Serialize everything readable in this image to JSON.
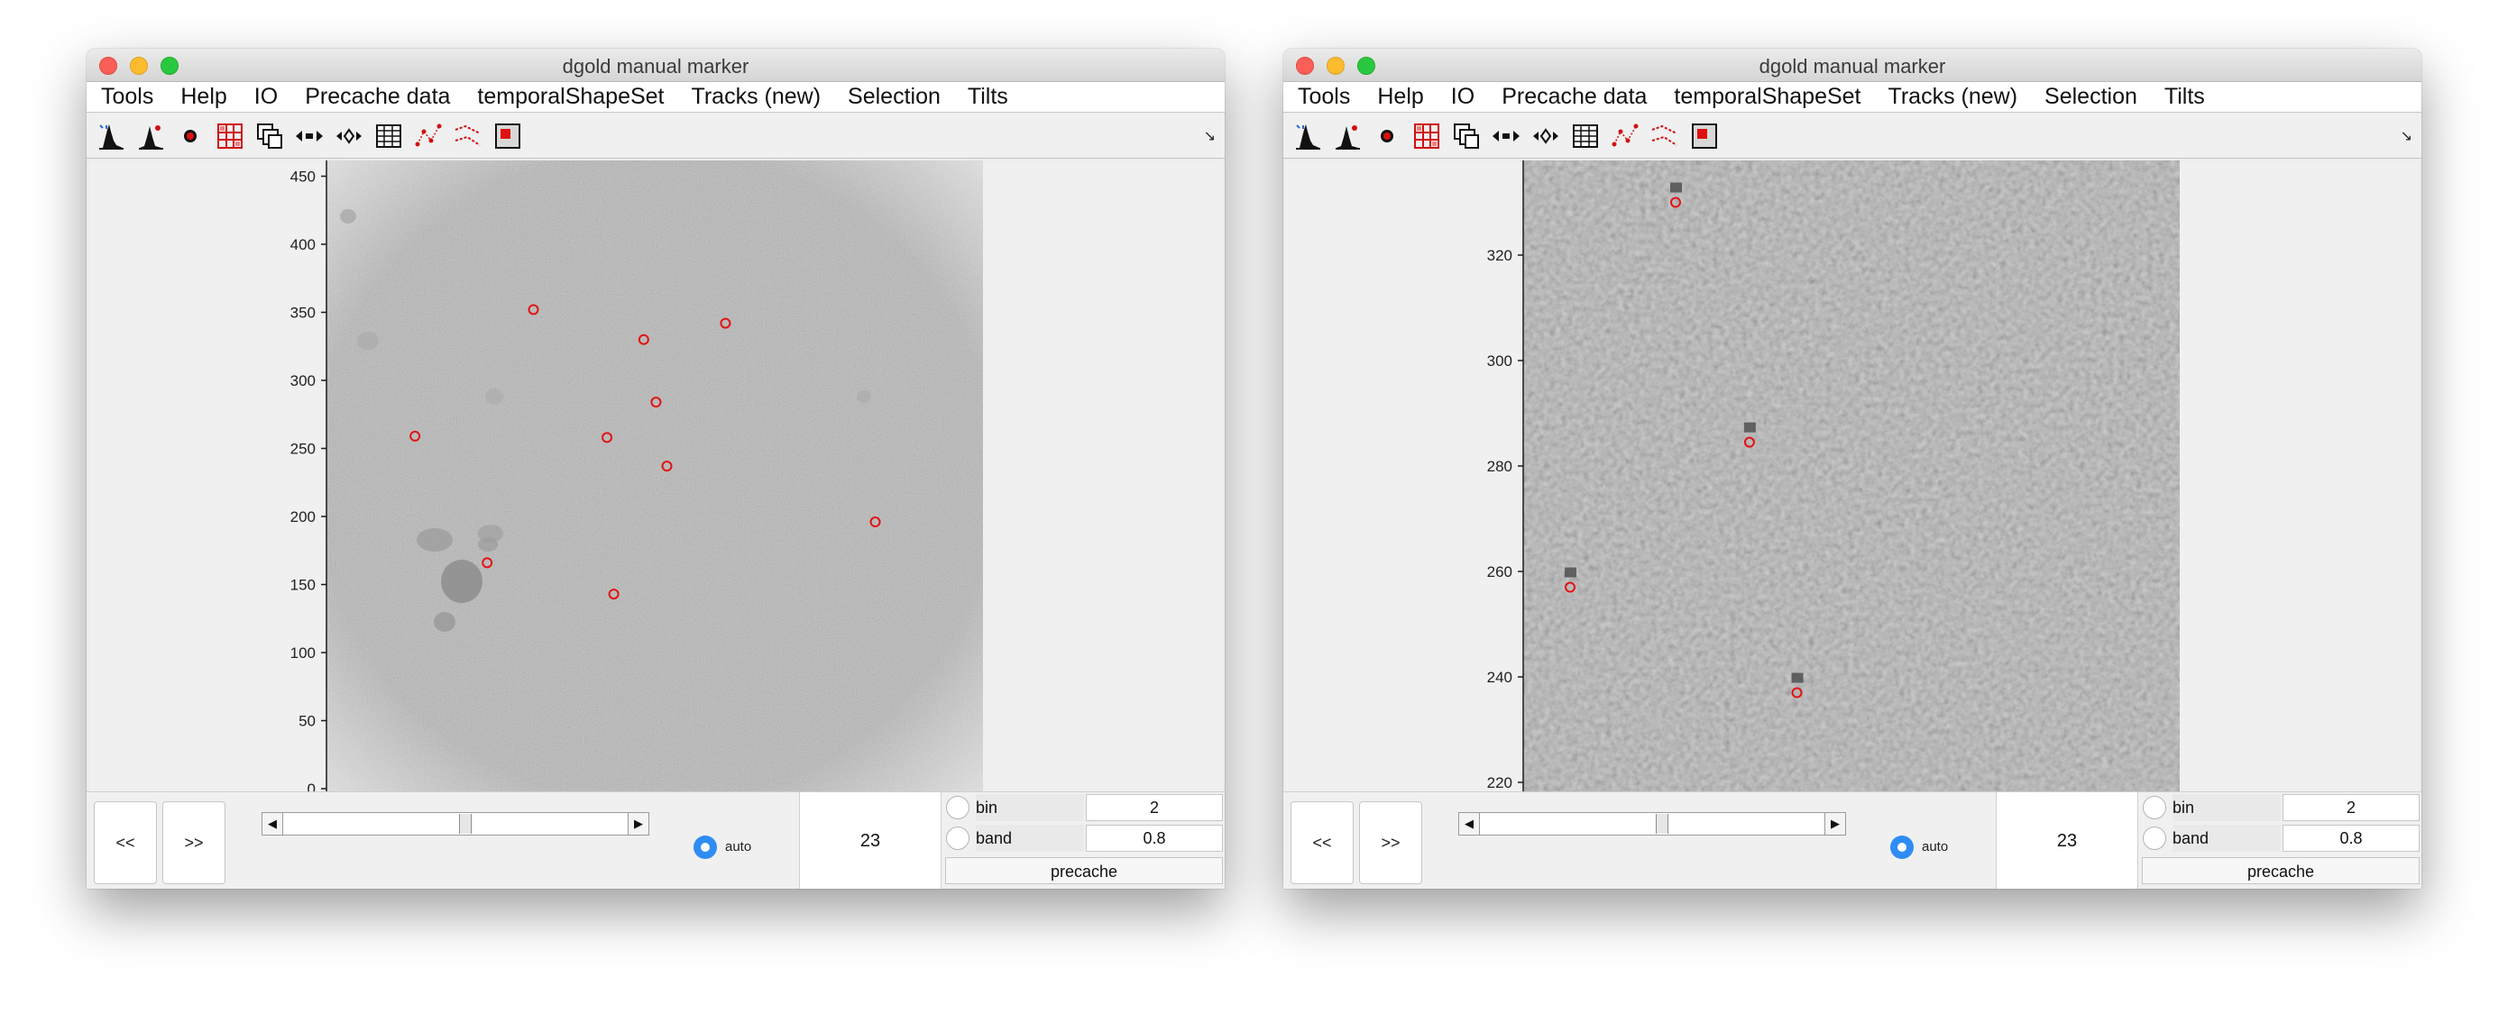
{
  "windows": [
    {
      "title": "dgold manual marker",
      "menu": [
        "Tools",
        "Help",
        "IO",
        "Precache data",
        "temporalShapeSet",
        "Tracks (new)",
        "Selection",
        "Tilts"
      ],
      "toolbar_icons": [
        "histogram-icon",
        "histogram-point-icon",
        "red-dot-icon",
        "red-grid-icon",
        "copy-stack-icon",
        "move-arrows-icon",
        "align-arrows-icon",
        "table-icon",
        "scatter-markers-icon",
        "track-lines-icon",
        "red-square-icon"
      ],
      "plot": {
        "yticks": [
          "450",
          "400",
          "350",
          "300",
          "250",
          "200",
          "150",
          "100",
          "50",
          "0"
        ],
        "markers": [
          {
            "x": 152,
            "y": 352
          },
          {
            "x": 233,
            "y": 330
          },
          {
            "x": 293,
            "y": 342
          },
          {
            "x": 242,
            "y": 284
          },
          {
            "x": 65,
            "y": 259
          },
          {
            "x": 206,
            "y": 258
          },
          {
            "x": 250,
            "y": 237
          },
          {
            "x": 403,
            "y": 196
          },
          {
            "x": 118,
            "y": 166
          },
          {
            "x": 211,
            "y": 143
          }
        ]
      },
      "controls": {
        "prev_label": "<<",
        "next_label": ">>",
        "auto_label": "auto",
        "frame_value": "23",
        "params": [
          {
            "label": "bin",
            "value": "2"
          },
          {
            "label": "band",
            "value": "0.8"
          }
        ],
        "precache_label": "precache"
      }
    },
    {
      "title": "dgold manual marker",
      "menu": [
        "Tools",
        "Help",
        "IO",
        "Precache data",
        "temporalShapeSet",
        "Tracks (new)",
        "Selection",
        "Tilts"
      ],
      "toolbar_icons": [
        "histogram-icon",
        "histogram-point-icon",
        "red-dot-icon",
        "red-grid-icon",
        "copy-stack-icon",
        "move-arrows-icon",
        "align-arrows-icon",
        "table-icon",
        "scatter-markers-icon",
        "track-lines-icon",
        "red-square-icon"
      ],
      "plot": {
        "yticks": [
          "320",
          "300",
          "280",
          "260",
          "240",
          "220"
        ],
        "markers": [
          {
            "x": 317,
            "y": 330
          },
          {
            "x": 331,
            "y": 284.5
          },
          {
            "x": 297,
            "y": 257
          },
          {
            "x": 340,
            "y": 237
          }
        ]
      },
      "controls": {
        "prev_label": "<<",
        "next_label": ">>",
        "auto_label": "auto",
        "frame_value": "23",
        "params": [
          {
            "label": "bin",
            "value": "2"
          },
          {
            "label": "band",
            "value": "0.8"
          }
        ],
        "precache_label": "precache"
      }
    }
  ]
}
